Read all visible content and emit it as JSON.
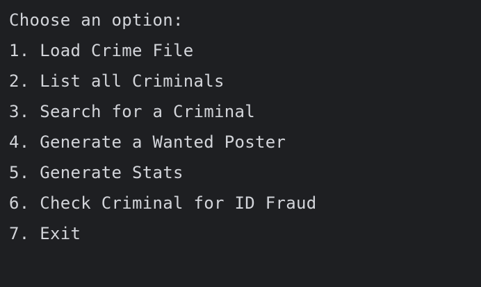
{
  "console": {
    "lines": [
      "Choose an option:",
      "1. Load Crime File",
      "2. List all Criminals",
      "3. Search for a Criminal",
      "4. Generate a Wanted Poster",
      "5. Generate Stats",
      "6. Check Criminal for ID Fraud",
      "7. Exit"
    ]
  },
  "colors": {
    "background": "#1e1f22",
    "text": "#d3d5da"
  }
}
